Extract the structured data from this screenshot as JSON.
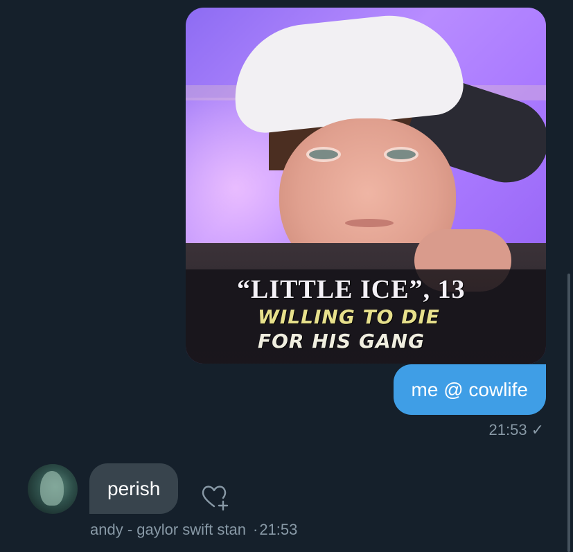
{
  "outgoing": {
    "image": {
      "caption_line1": "“LITTLE ICE”, 13",
      "caption_line2": "WILLING TO DIE",
      "caption_line3": "FOR HIS GANG"
    },
    "text": "me @ cowlife",
    "time": "21:53",
    "status_icon": "check-icon"
  },
  "incoming": {
    "avatar_icon": "user-avatar",
    "text": "perish",
    "sender": "andy - gaylor swift stan",
    "time_sep": "·",
    "time": "21:53",
    "reaction_icon": "heart-plus-icon"
  },
  "colors": {
    "background": "#15202b",
    "outgoing_bubble": "#3f9ee6",
    "incoming_bubble": "#38444d",
    "meta_text": "#8899a6"
  }
}
